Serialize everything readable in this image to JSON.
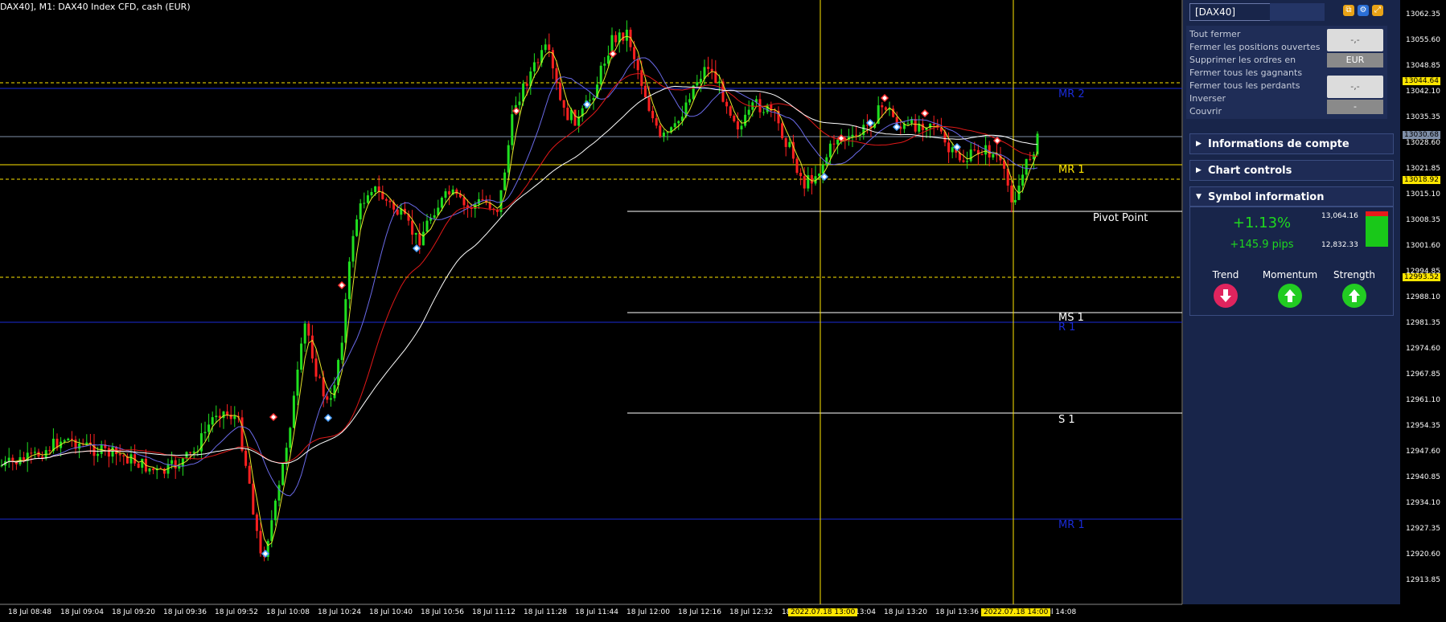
{
  "chart": {
    "title": "DAX40], M1:  DAX40 Index CFD, cash (EUR)",
    "price_ticks": [
      "13062.35",
      "13055.60",
      "13048.85",
      "13042.10",
      "13035.35",
      "13028.60",
      "13021.85",
      "13015.10",
      "13008.35",
      "13001.60",
      "12994.85",
      "12988.10",
      "12981.35",
      "12974.60",
      "12967.85",
      "12961.10",
      "12954.35",
      "12947.60",
      "12940.85",
      "12934.10",
      "12927.35",
      "12920.60",
      "12913.85"
    ],
    "price_highlights": [
      {
        "label": "13044.64",
        "color": "#ffe600",
        "text": "#000"
      },
      {
        "label": "13030.68",
        "color": "#7f8fa8",
        "text": "#000"
      },
      {
        "label": "13018.92",
        "color": "#ffe600",
        "text": "#000"
      },
      {
        "label": "12993.52",
        "color": "#ffe600",
        "text": "#000"
      }
    ],
    "time_ticks": [
      "18 Jul 08:48",
      "18 Jul 09:04",
      "18 Jul 09:20",
      "18 Jul 09:36",
      "18 Jul 09:52",
      "18 Jul 10:08",
      "18 Jul 10:24",
      "18 Jul 10:40",
      "18 Jul 10:56",
      "18 Jul 11:12",
      "18 Jul 11:28",
      "18 Jul 11:44",
      "18 Jul 12:00",
      "18 Jul 12:16",
      "18 Jul 12:32",
      "18",
      "13:04",
      "18 Jul 13:20",
      "18 Jul 13:36",
      "8 Jul 14:08"
    ],
    "time_highlights": [
      "2022.07.18 13:00",
      "2022.07.18 14:00"
    ],
    "levels": [
      {
        "name": "MR 2",
        "color": "#1a2bd6"
      },
      {
        "name": "MR 1",
        "color": "#ffe600"
      },
      {
        "name": "Pivot Point",
        "color": "#ffffff"
      },
      {
        "name": "MS 1",
        "color": "#ffffff"
      },
      {
        "name": "R 1",
        "color": "#1a2bd6"
      },
      {
        "name": "S 1",
        "color": "#ffffff"
      },
      {
        "name": "MR 1",
        "color": "#1a2bd6"
      }
    ]
  },
  "panel": {
    "symbol_select": "[DAX40]",
    "trade_actions": [
      "Tout fermer",
      "Fermer les positions ouvertes",
      "Supprimer les ordres en",
      "Fermer tous les gagnants",
      "Fermer tous les perdants",
      "Inverser",
      "Couvrir"
    ],
    "btn_top_value": "-,-",
    "btn_currency": "EUR",
    "btn_bottom_value": "-,-",
    "btn_dash": "-",
    "sections": [
      "Informations de compte",
      "Chart controls",
      "Symbol information"
    ],
    "symbol_info": {
      "change_pct": "+1.13%",
      "change_pips": "+145.9 pips",
      "high": "13,064.16",
      "low": "12,832.33",
      "indicators": [
        {
          "label": "Trend",
          "direction": "down",
          "color": "#e0245e"
        },
        {
          "label": "Momentum",
          "direction": "up",
          "color": "#22cc22"
        },
        {
          "label": "Strength",
          "direction": "up",
          "color": "#22cc22"
        }
      ]
    }
  }
}
